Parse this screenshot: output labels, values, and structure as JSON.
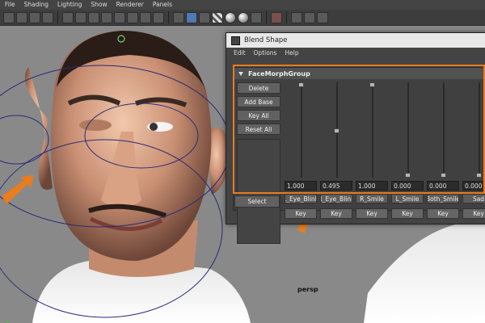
{
  "menubar": {
    "items": [
      "File",
      "Shading",
      "Lighting",
      "Show",
      "Renderer",
      "Panels"
    ]
  },
  "viewport": {
    "camera_label": "persp"
  },
  "blend_shape": {
    "title": "Blend Shape",
    "menu": [
      "Edit",
      "Options",
      "Help"
    ],
    "group_name": "FaceMorphGroup",
    "buttons": {
      "delete": "Delete",
      "add_base": "Add Base",
      "key_all": "Key All",
      "reset_all": "Reset All",
      "select": "Select"
    },
    "targets": [
      {
        "name": "L_Eye_Blink",
        "value": "1.000",
        "weight": 1.0,
        "key": "Key"
      },
      {
        "name": "R_Eye_Blink",
        "value": "0.495",
        "weight": 0.495,
        "key": "Key"
      },
      {
        "name": "R_Smile",
        "value": "1.000",
        "weight": 1.0,
        "key": "Key"
      },
      {
        "name": "L_Smile",
        "value": "0.000",
        "weight": 0.0,
        "key": "Key"
      },
      {
        "name": "Both_Smile",
        "value": "0.000",
        "weight": 0.0,
        "key": "Key"
      },
      {
        "name": "Sad",
        "value": "0.000",
        "weight": 0.0,
        "key": "Key"
      }
    ]
  },
  "colors": {
    "highlight": "#e87c1e",
    "viewport_bg": "#898989",
    "rig_curve": "#2a2a7a"
  }
}
